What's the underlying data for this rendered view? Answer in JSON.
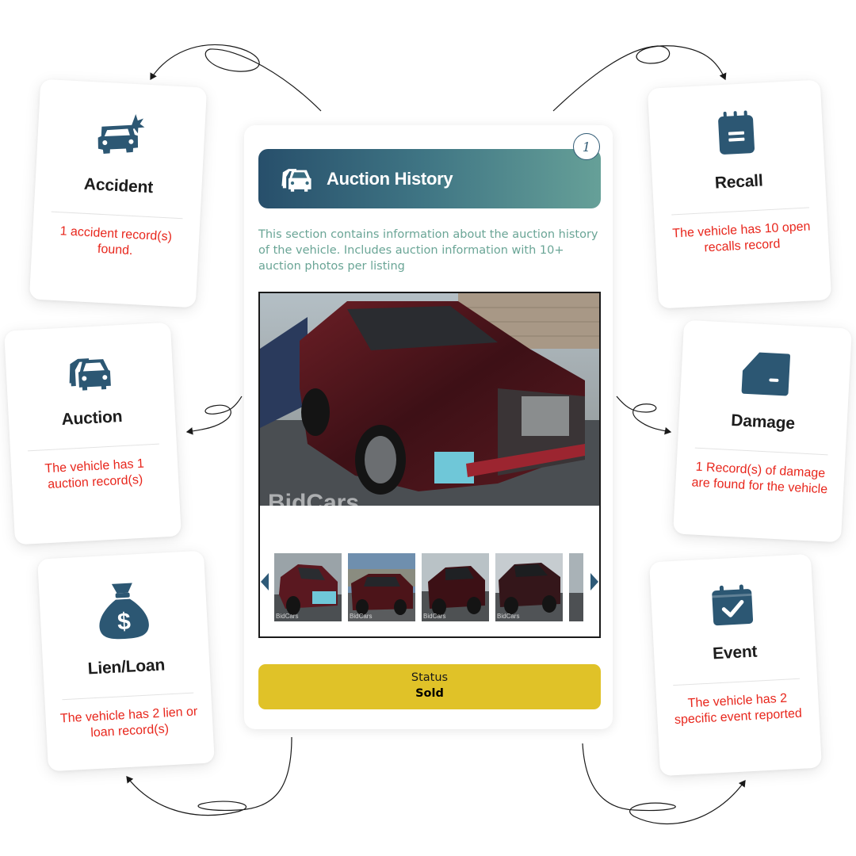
{
  "colors": {
    "icon": "#2c5773",
    "card_text": "#e8271d",
    "header_gradient_start": "#274f6b",
    "header_gradient_end": "#66a098",
    "description_text": "#6aa596",
    "status_bg": "#e0c228"
  },
  "cards": {
    "accident": {
      "icon": "car-crash-icon",
      "title": "Accident",
      "desc": "1 accident record(s) found."
    },
    "auction": {
      "icon": "cars-icon",
      "title": "Auction",
      "desc": "The vehicle has 1 auction record(s)"
    },
    "lien": {
      "icon": "money-bag-icon",
      "title": "Lien/Loan",
      "desc": "The vehicle has 2 lien or loan record(s)"
    },
    "recall": {
      "icon": "notepad-icon",
      "title": "Recall",
      "desc": "The vehicle has 10 open recalls record"
    },
    "damage": {
      "icon": "car-door-icon",
      "title": "Damage",
      "desc": "1 Record(s) of damage are found for the vehicle"
    },
    "event": {
      "icon": "calendar-check-icon",
      "title": "Event",
      "desc": "The vehicle has 2 specific event reported"
    }
  },
  "panel": {
    "step": "1",
    "header_icon": "cars-icon",
    "title": "Auction History",
    "description": "This section contains information about the auction history of the vehicle. Includes auction information with 10+ auction photos per listing",
    "gallery": {
      "watermark": "BidCars",
      "thumbnails": [
        {
          "watermark": "BidCars"
        },
        {
          "watermark": "BidCars"
        },
        {
          "watermark": "BidCars"
        },
        {
          "watermark": "BidCars"
        }
      ]
    },
    "status": {
      "label": "Status",
      "value": "Sold"
    }
  }
}
